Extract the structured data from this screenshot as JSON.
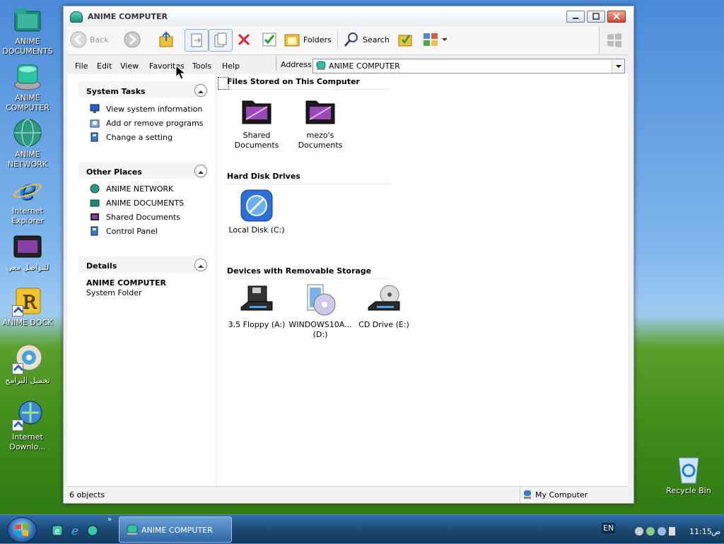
{
  "desktop_icons": [
    {
      "label": "ANIME DOCUMENTS"
    },
    {
      "label": "ANIME COMPUTER"
    },
    {
      "label": "ANIME NETWORK"
    },
    {
      "label": "Internet Explorer"
    },
    {
      "label": "للتواصل معي"
    },
    {
      "label": "ANIME DOCK"
    },
    {
      "label": "تحميل البرامج"
    },
    {
      "label": "Internet Downlo..."
    },
    {
      "label": "Recycle Bin"
    }
  ],
  "window": {
    "title": "ANIME COMPUTER"
  },
  "toolbar": {
    "back": "Back",
    "folders": "Folders",
    "search": "Search"
  },
  "menu": [
    "File",
    "Edit",
    "View",
    "Favorites",
    "Tools",
    "Help"
  ],
  "address": {
    "label": "Address",
    "value": "ANIME COMPUTER"
  },
  "left_pane": {
    "system_tasks": {
      "title": "System Tasks",
      "items": [
        "View system information",
        "Add or remove programs",
        "Change a setting"
      ]
    },
    "other_places": {
      "title": "Other Places",
      "items": [
        "ANIME NETWORK",
        "ANIME DOCUMENTS",
        "Shared Documents",
        "Control Panel"
      ]
    },
    "details": {
      "title": "Details",
      "name": "ANIME COMPUTER",
      "type": "System Folder"
    }
  },
  "main": {
    "files_section": "Files Stored on This Computer",
    "files": [
      "Shared Documents",
      "mezo's Documents"
    ],
    "disks_section": "Hard Disk Drives",
    "disks": [
      "Local Disk (C:)"
    ],
    "removable_section": "Devices with Removable Storage",
    "removable": [
      "3.5 Floppy (A:)",
      "WINDOWS10A... (D:)",
      "CD Drive (E:)"
    ]
  },
  "status": {
    "objects": "6 objects",
    "location": "My Computer"
  },
  "taskbar": {
    "active_window": "ANIME COMPUTER",
    "language": "EN",
    "time": "11:15",
    "ampm": "ص",
    "chevron": "»"
  }
}
